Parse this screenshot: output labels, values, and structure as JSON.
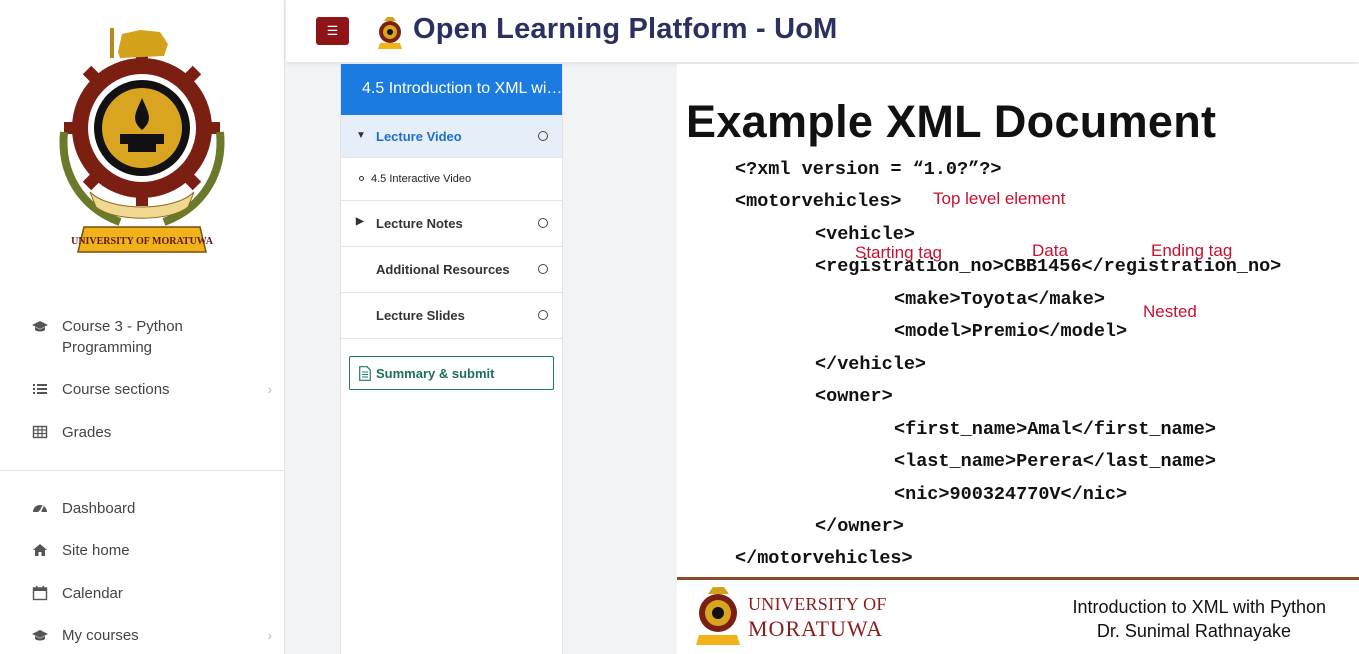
{
  "navbar": {
    "title": "Open Learning Platform - UoM",
    "menu_toggle_icon": "hamburger-icon"
  },
  "drawer": {
    "course_items": [
      {
        "label": "Course 3 - Python Programming",
        "icon": "graduation-cap-icon"
      },
      {
        "label": "Course sections",
        "icon": "list-icon"
      },
      {
        "label": "Grades",
        "icon": "table-icon"
      }
    ],
    "site_items": [
      {
        "label": "Dashboard",
        "icon": "tachometer-icon"
      },
      {
        "label": "Site home",
        "icon": "home-icon"
      },
      {
        "label": "Calendar",
        "icon": "calendar-icon"
      },
      {
        "label": "My courses",
        "icon": "graduation-cap-icon"
      }
    ]
  },
  "course_index": {
    "header": "4.5 Introduction to XML wi…",
    "items": [
      {
        "label": "Lecture Video"
      },
      {
        "label": "4.5 Interactive Video"
      },
      {
        "label": "Lecture Notes"
      },
      {
        "label": "Additional Resources"
      },
      {
        "label": "Lecture Slides"
      }
    ],
    "summary_button": "Summary & submit"
  },
  "slide": {
    "title": "Example XML Document",
    "code_lines": [
      "<?xml version = “1.0?”?>",
      "<motorvehicles>",
      "<vehicle>",
      "<registration_no>CBB1456</registration_no>",
      "<make>Toyota</make>",
      "<model>Premio</model>",
      "</vehicle>",
      "<owner>",
      "<first_name>Amal</first_name>",
      "<last_name>Perera</last_name>",
      "<nic>900324770V</nic>",
      "</owner>",
      "</motorvehicles>"
    ],
    "annotations": {
      "top_level": "Top level element",
      "starting_tag": "Starting tag",
      "data": "Data",
      "ending_tag": "Ending tag",
      "nested": "Nested"
    },
    "footer": {
      "university_line1": "UNIVERSITY OF",
      "university_line2": "MORATUWA",
      "course_line": "Introduction to XML with Python",
      "lecturer": "Dr. Sunimal Rathnayake"
    }
  },
  "colors": {
    "accent_blue": "#1c7be0",
    "brand_maroon": "#8f1418",
    "title_navy": "#2b3060",
    "annotation_red": "#c8102e",
    "summary_green": "#1d7a6b"
  }
}
